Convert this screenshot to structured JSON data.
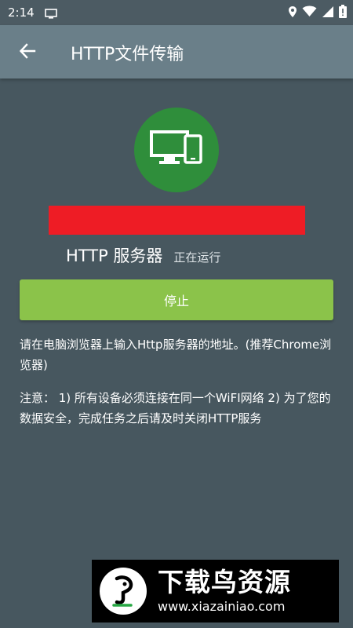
{
  "status_bar": {
    "time": "2:14"
  },
  "app_bar": {
    "title": "HTTP文件传输",
    "back_icon": "arrow-back-icon"
  },
  "server": {
    "icon": "devices-icon",
    "label": "HTTP 服务器",
    "status": "正在运行"
  },
  "actions": {
    "stop_label": "停止"
  },
  "instructions": {
    "line": "请在电脑浏览器上输入Http服务器的地址。(推荐Chrome浏览器)",
    "notice": "注意： 1) 所有设备必须连接在同一个WiFI网络 2) 为了您的数据安全，完成任务之后请及时关闭HTTP服务"
  },
  "watermark": {
    "title": "下载鸟资源",
    "url": "www.xiazainiao.com"
  },
  "colors": {
    "background": "#47575f",
    "app_bar": "#6a7f89",
    "device_circle": "#2f8e3b",
    "redaction": "#ee1c25",
    "stop_button": "#8bc34a"
  }
}
